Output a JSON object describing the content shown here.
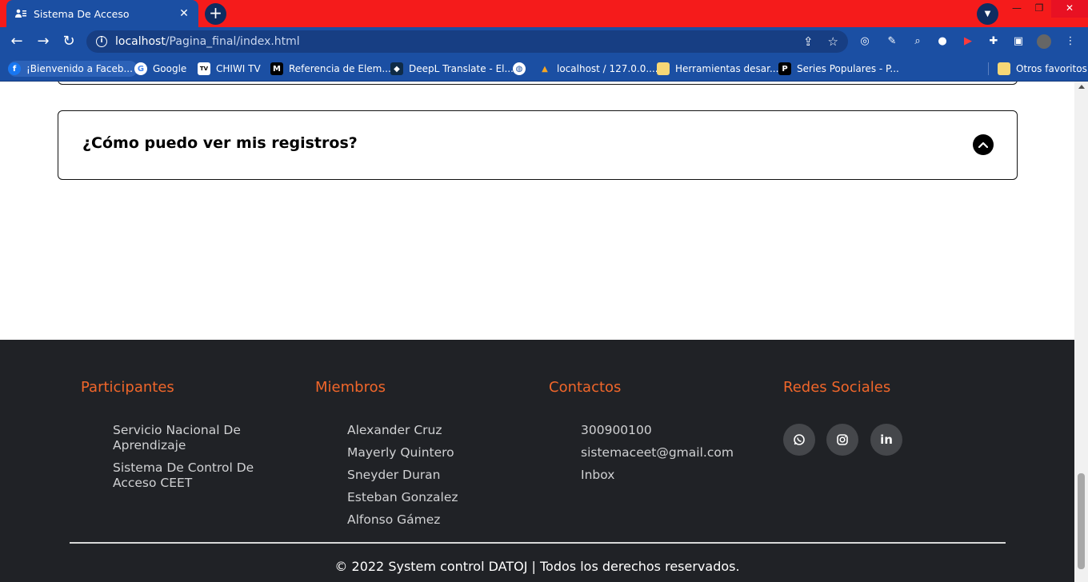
{
  "browser": {
    "tab_title": "Sistema De Acceso",
    "url_host": "localhost",
    "url_path": "/Pagina_final/index.html",
    "bookmarks": [
      {
        "label": "¡Bienvenido a Faceb...",
        "icon": "facebook-icon"
      },
      {
        "label": "Google",
        "icon": "google-icon"
      },
      {
        "label": "CHIWI TV",
        "icon": "tv-icon"
      },
      {
        "label": "Referencia de Elem...",
        "icon": "mdn-icon"
      },
      {
        "label": "DeepL Translate - El...",
        "icon": "deepl-icon"
      },
      {
        "label": "",
        "icon": "globe-icon"
      },
      {
        "label": "localhost / 127.0.0....",
        "icon": "phpmyadmin-icon"
      },
      {
        "label": "Herramientas desar...",
        "icon": "folder-icon"
      },
      {
        "label": "Series Populares - P...",
        "icon": "p-icon"
      },
      {
        "label": "Otros favoritos",
        "icon": "folder-icon"
      }
    ]
  },
  "faq": {
    "question": "¿Cómo puedo ver mis registros?"
  },
  "footer": {
    "participantes": {
      "title": "Participantes",
      "items": [
        "Servicio Nacional De Aprendizaje",
        "Sistema De Control De Acceso CEET"
      ]
    },
    "miembros": {
      "title": "Miembros",
      "items": [
        "Alexander Cruz",
        "Mayerly Quintero",
        "Sneyder Duran",
        "Esteban Gonzalez",
        "Alfonso Gámez"
      ]
    },
    "contactos": {
      "title": "Contactos",
      "items": [
        "300900100",
        "sistemaceet@gmail.com",
        "Inbox"
      ]
    },
    "redes": {
      "title": "Redes Sociales",
      "icons": [
        "whatsapp-icon",
        "instagram-icon",
        "linkedin-icon"
      ]
    },
    "copyright": "© 2022 System control DATOJ | Todos los derechos reservados."
  },
  "colors": {
    "titlebar": "#f51b1b",
    "chrome_blue": "#1b4fa3",
    "footer_bg": "#202226",
    "accent_orange": "#f0662a"
  }
}
